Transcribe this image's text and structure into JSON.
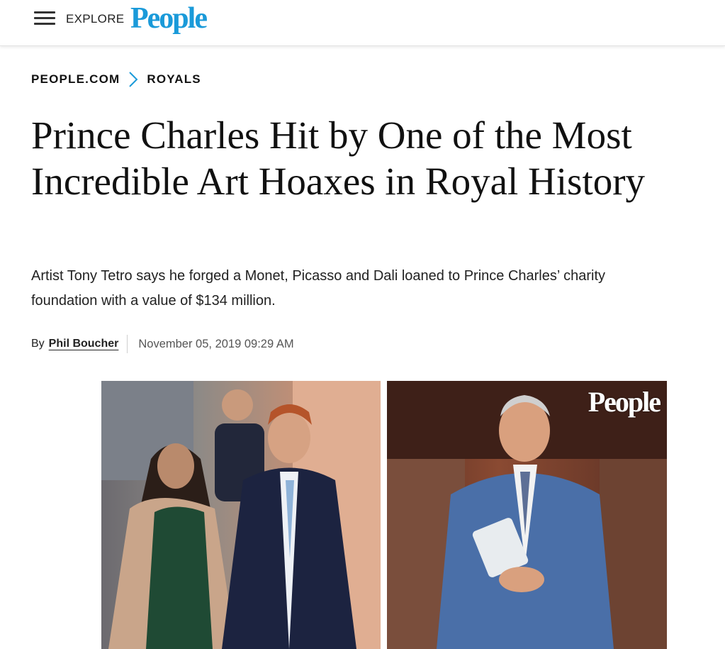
{
  "header": {
    "explore_label": "EXPLORE",
    "logo_text": "People",
    "logo_color": "#1a9ad9"
  },
  "breadcrumb": {
    "items": [
      "PEOPLE.COM",
      "ROYALS"
    ],
    "separator_color": "#1a9ad9"
  },
  "article": {
    "headline": "Prince Charles Hit by One of the Most Incredible Art Hoaxes in Royal History",
    "dek": "Artist Tony Tetro says he forged a Monet, Picasso and Dali loaned to Prince Charles’ charity foundation with a value of $134 million.",
    "byline_prefix": "By",
    "author": "Phil Boucher",
    "date": "November 05, 2019 09:29 AM"
  },
  "hero": {
    "watermark": "People"
  }
}
